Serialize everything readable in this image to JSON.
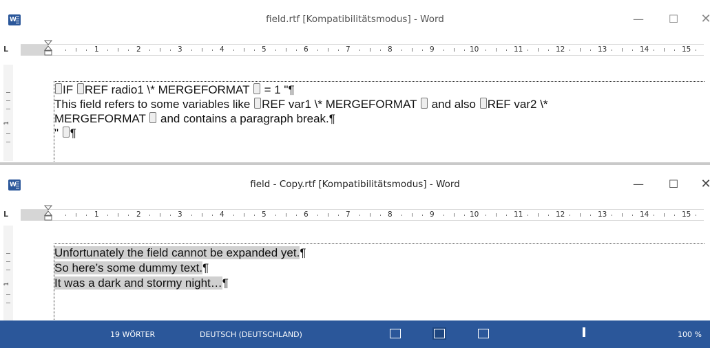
{
  "windows": [
    {
      "title": "field.rtf [Kompatibilitätsmodus] - Word",
      "controls": {
        "minimize": "—",
        "maximize": "☐",
        "close": "✕"
      },
      "ruler_labels": [
        "1",
        "2",
        "3",
        "4",
        "5",
        "6",
        "7",
        "8",
        "9",
        "10",
        "11",
        "12",
        "13",
        "14",
        "15"
      ],
      "vruler_label": "1",
      "lines": [
        {
          "pre": "",
          "field1": "",
          "text1": "IF ",
          "field2": "",
          "text2": "REF radio1 \\* MERGEFORMAT ",
          "field3": "",
          "text3": " = 1 \"¶"
        },
        {
          "text": "This field refers to some variables like ",
          "field": "",
          "text_b": "REF var1 \\* MERGEFORMAT ",
          "text_c": " and also ",
          "text_d": "REF var2 \\*"
        },
        {
          "text": "MERGEFORMAT ",
          "text_b": " and contains a paragraph break.¶"
        },
        {
          "text": "\" ",
          "text_b": "¶"
        }
      ]
    },
    {
      "title": "field - Copy.rtf [Kompatibilitätsmodus] - Word",
      "controls": {
        "minimize": "—",
        "maximize": "☐",
        "close": "✕"
      },
      "ruler_labels": [
        "1",
        "2",
        "3",
        "4",
        "5",
        "6",
        "7",
        "8",
        "9",
        "10",
        "11",
        "12",
        "13",
        "14",
        "15"
      ],
      "vruler_label": "1",
      "lines": [
        {
          "text": "Unfortunately the field cannot be expanded yet.",
          "mark": "¶"
        },
        {
          "text": "So here’s some dummy text.",
          "mark": "¶"
        },
        {
          "text": "It was a dark and stormy night…",
          "mark": "¶"
        }
      ]
    }
  ],
  "statusbar": {
    "words": "19 WÖRTER",
    "language": "DEUTSCH (DEUTSCHLAND)",
    "zoom": "100 %"
  },
  "colors": {
    "accent": "#2b579a",
    "field_shade": "#d0d0d0"
  },
  "icons": [
    "word-logo-icon",
    "minimize-icon",
    "maximize-icon",
    "close-icon",
    "read-mode-icon",
    "print-layout-icon",
    "web-layout-icon"
  ]
}
